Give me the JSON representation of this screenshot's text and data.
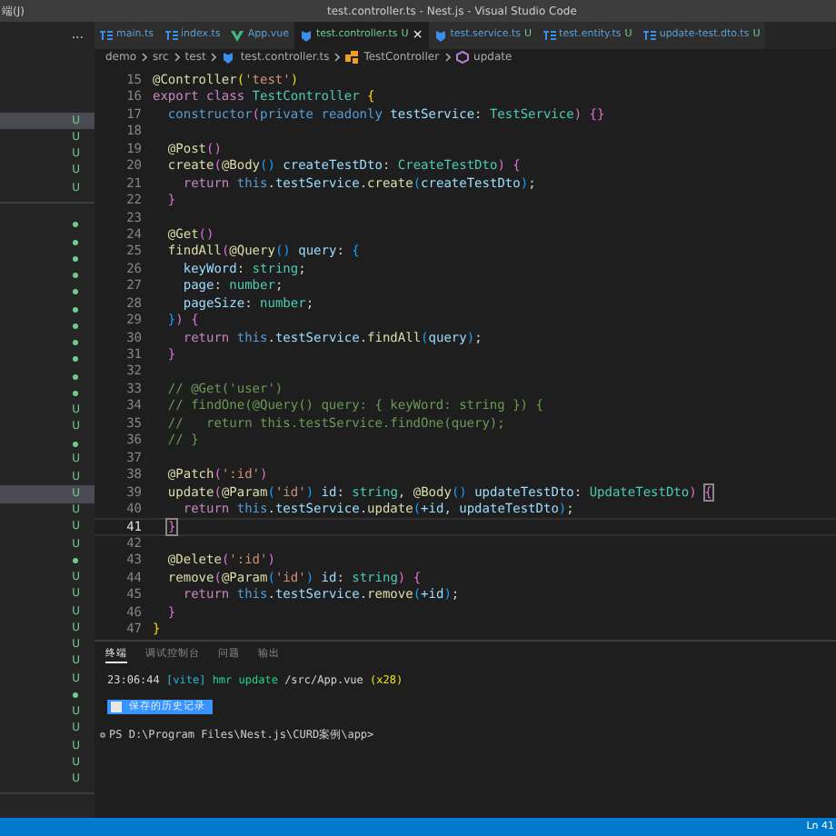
{
  "title_bar": {
    "menu_fragment": "端(J)",
    "title": "test.controller.ts - Nest.js - Visual Studio Code"
  },
  "sidebar": {
    "more": "...",
    "sections": [
      {
        "rows": [
          {
            "kind": "untracked",
            "mark": "U",
            "selected": true
          },
          {
            "kind": "untracked",
            "mark": "U",
            "selected": false
          },
          {
            "kind": "untracked",
            "mark": "U",
            "selected": false
          },
          {
            "kind": "untracked",
            "mark": "U",
            "selected": false
          },
          {
            "kind": "untracked",
            "mark": "U",
            "selected": false
          }
        ]
      },
      {
        "rows": [
          {
            "kind": "dot",
            "selected": false
          },
          {
            "kind": "dot",
            "selected": false
          },
          {
            "kind": "dot",
            "selected": false
          },
          {
            "kind": "dot",
            "selected": false
          },
          {
            "kind": "dot",
            "selected": false
          },
          {
            "kind": "dot",
            "selected": false
          },
          {
            "kind": "dot",
            "selected": false
          },
          {
            "kind": "dot",
            "selected": false
          },
          {
            "kind": "dot",
            "selected": false
          },
          {
            "kind": "dot",
            "selected": false
          },
          {
            "kind": "dot",
            "selected": false
          },
          {
            "kind": "untracked",
            "mark": "U",
            "selected": false
          },
          {
            "kind": "untracked",
            "mark": "U",
            "selected": false
          },
          {
            "kind": "dot",
            "selected": false
          },
          {
            "kind": "untracked",
            "mark": "U",
            "selected": false
          },
          {
            "kind": "untracked",
            "mark": "U",
            "selected": false
          },
          {
            "kind": "untracked",
            "mark": "U",
            "selected": true
          },
          {
            "kind": "untracked",
            "mark": "U",
            "selected": false
          },
          {
            "kind": "untracked",
            "mark": "U",
            "selected": false
          },
          {
            "kind": "untracked",
            "mark": "U",
            "selected": false
          },
          {
            "kind": "dot",
            "selected": false
          },
          {
            "kind": "untracked",
            "mark": "U",
            "selected": false
          },
          {
            "kind": "untracked",
            "mark": "U",
            "selected": false
          },
          {
            "kind": "untracked",
            "mark": "U",
            "selected": false
          },
          {
            "kind": "untracked",
            "mark": "U",
            "selected": false
          },
          {
            "kind": "untracked",
            "mark": "U",
            "selected": false
          },
          {
            "kind": "untracked",
            "mark": "U",
            "selected": false
          },
          {
            "kind": "untracked",
            "mark": "U",
            "selected": false
          },
          {
            "kind": "dot",
            "selected": false
          },
          {
            "kind": "untracked",
            "mark": "U",
            "selected": false
          },
          {
            "kind": "untracked",
            "mark": "U",
            "selected": false
          },
          {
            "kind": "untracked",
            "mark": "U",
            "selected": false
          },
          {
            "kind": "untracked",
            "mark": "U",
            "selected": false
          },
          {
            "kind": "untracked",
            "mark": "U",
            "selected": false
          }
        ]
      }
    ]
  },
  "tabs": [
    {
      "label": "main.ts",
      "kind": "ts",
      "selected": false
    },
    {
      "label": "index.ts",
      "kind": "ts",
      "selected": false
    },
    {
      "label": "App.vue",
      "kind": "vue",
      "selected": false
    },
    {
      "label": "test.controller.ts",
      "kind": "nest",
      "badge": "U",
      "close": "×",
      "selected": true
    },
    {
      "label": "test.service.ts",
      "kind": "nest",
      "badge": "U",
      "selected": false
    },
    {
      "label": "test.entity.ts",
      "kind": "ts",
      "badge": "U",
      "selected": false
    },
    {
      "label": "update-test.dto.ts",
      "kind": "ts",
      "badge": "U",
      "selected": false
    }
  ],
  "breadcrumb": [
    {
      "label": "demo",
      "kind": "folder"
    },
    {
      "label": "src",
      "kind": "folder"
    },
    {
      "label": "test",
      "kind": "folder"
    },
    {
      "label": "test.controller.ts",
      "kind": "file"
    },
    {
      "label": "TestController",
      "kind": "class"
    },
    {
      "label": "update",
      "kind": "method"
    }
  ],
  "code_lines": [
    {
      "number": "15",
      "current": false,
      "tokens": [
        {
          "text": "@Controller",
          "kind": "fn"
        },
        {
          "text": "(",
          "kind": "b1"
        },
        {
          "text": "'test'",
          "kind": "str"
        },
        {
          "text": ")",
          "kind": "b1"
        }
      ]
    },
    {
      "number": "16",
      "current": false,
      "tokens": [
        {
          "text": "export class ",
          "kind": "kw"
        },
        {
          "text": "TestController",
          "kind": "type"
        },
        {
          "text": " {",
          "kind": "b1"
        }
      ]
    },
    {
      "number": "17",
      "current": false,
      "tokens": [
        {
          "text": "  constructor",
          "kind": "st"
        },
        {
          "text": "(",
          "kind": "b2"
        },
        {
          "text": "private readonly ",
          "kind": "st"
        },
        {
          "text": "testService",
          "kind": "var"
        },
        {
          "text": ": ",
          "kind": "p"
        },
        {
          "text": "TestService",
          "kind": "type"
        },
        {
          "text": ")",
          "kind": "b2"
        },
        {
          "text": " {}",
          "kind": "b2"
        }
      ]
    },
    {
      "number": "18",
      "current": false
    },
    {
      "number": "19",
      "current": false,
      "tokens": [
        {
          "text": "  @Post",
          "kind": "fn"
        },
        {
          "text": "()",
          "kind": "b2"
        }
      ]
    },
    {
      "number": "20",
      "current": false,
      "tokens": [
        {
          "text": "  create",
          "kind": "fn"
        },
        {
          "text": "(",
          "kind": "b2"
        },
        {
          "text": "@Body",
          "kind": "fn"
        },
        {
          "text": "()",
          "kind": "b3"
        },
        {
          "text": " createTestDto",
          "kind": "var"
        },
        {
          "text": ": ",
          "kind": "p"
        },
        {
          "text": "CreateTestDto",
          "kind": "type"
        },
        {
          "text": ")",
          "kind": "b2"
        },
        {
          "text": " {",
          "kind": "b2"
        }
      ]
    },
    {
      "number": "21",
      "current": false,
      "tokens": [
        {
          "text": "    return",
          "kind": "kw"
        },
        {
          "text": " this",
          "kind": "st"
        },
        {
          "text": ".",
          "kind": "p"
        },
        {
          "text": "testService",
          "kind": "var"
        },
        {
          "text": ".",
          "kind": "p"
        },
        {
          "text": "create",
          "kind": "fn"
        },
        {
          "text": "(",
          "kind": "b3"
        },
        {
          "text": "createTestDto",
          "kind": "var"
        },
        {
          "text": ")",
          "kind": "b3"
        },
        {
          "text": ";",
          "kind": "p"
        }
      ]
    },
    {
      "number": "22",
      "current": false,
      "tokens": [
        {
          "text": "  }",
          "kind": "b2"
        }
      ]
    },
    {
      "number": "23",
      "current": false
    },
    {
      "number": "24",
      "current": false,
      "tokens": [
        {
          "text": "  @Get",
          "kind": "fn"
        },
        {
          "text": "()",
          "kind": "b2"
        }
      ]
    },
    {
      "number": "25",
      "current": false,
      "tokens": [
        {
          "text": "  findAll",
          "kind": "fn"
        },
        {
          "text": "(",
          "kind": "b2"
        },
        {
          "text": "@Query",
          "kind": "fn"
        },
        {
          "text": "()",
          "kind": "b3"
        },
        {
          "text": " query",
          "kind": "var"
        },
        {
          "text": ": ",
          "kind": "p"
        },
        {
          "text": "{",
          "kind": "b3"
        }
      ]
    },
    {
      "number": "26",
      "current": false,
      "tokens": [
        {
          "text": "    keyWord",
          "kind": "var"
        },
        {
          "text": ": ",
          "kind": "p"
        },
        {
          "text": "string",
          "kind": "type"
        },
        {
          "text": ";",
          "kind": "p"
        }
      ]
    },
    {
      "number": "27",
      "current": false,
      "tokens": [
        {
          "text": "    page",
          "kind": "var"
        },
        {
          "text": ": ",
          "kind": "p"
        },
        {
          "text": "number",
          "kind": "type"
        },
        {
          "text": ";",
          "kind": "p"
        }
      ]
    },
    {
      "number": "28",
      "current": false,
      "tokens": [
        {
          "text": "    pageSize",
          "kind": "var"
        },
        {
          "text": ": ",
          "kind": "p"
        },
        {
          "text": "number",
          "kind": "type"
        },
        {
          "text": ";",
          "kind": "p"
        }
      ]
    },
    {
      "number": "29",
      "current": false,
      "tokens": [
        {
          "text": "  }",
          "kind": "b3"
        },
        {
          "text": ")",
          "kind": "b2"
        },
        {
          "text": " {",
          "kind": "b2"
        }
      ]
    },
    {
      "number": "30",
      "current": false,
      "tokens": [
        {
          "text": "    return",
          "kind": "kw"
        },
        {
          "text": " this",
          "kind": "st"
        },
        {
          "text": ".",
          "kind": "p"
        },
        {
          "text": "testService",
          "kind": "var"
        },
        {
          "text": ".",
          "kind": "p"
        },
        {
          "text": "findAll",
          "kind": "fn"
        },
        {
          "text": "(",
          "kind": "b3"
        },
        {
          "text": "query",
          "kind": "var"
        },
        {
          "text": ")",
          "kind": "b3"
        },
        {
          "text": ";",
          "kind": "p"
        }
      ]
    },
    {
      "number": "31",
      "current": false,
      "tokens": [
        {
          "text": "  }",
          "kind": "b2"
        }
      ]
    },
    {
      "number": "32",
      "current": false
    },
    {
      "number": "33",
      "current": false,
      "tokens": [
        {
          "text": "  // @Get('user')",
          "kind": "com"
        }
      ]
    },
    {
      "number": "34",
      "current": false,
      "tokens": [
        {
          "text": "  // findOne(@Query() query: { keyWord: string }) {",
          "kind": "com"
        }
      ]
    },
    {
      "number": "35",
      "current": false,
      "tokens": [
        {
          "text": "  //   return this.testService.findOne(query);",
          "kind": "com"
        }
      ]
    },
    {
      "number": "36",
      "current": false,
      "tokens": [
        {
          "text": "  // }",
          "kind": "com"
        }
      ]
    },
    {
      "number": "37",
      "current": false
    },
    {
      "number": "38",
      "current": false,
      "tokens": [
        {
          "text": "  @Patch",
          "kind": "fn"
        },
        {
          "text": "(",
          "kind": "b2"
        },
        {
          "text": "':id'",
          "kind": "str"
        },
        {
          "text": ")",
          "kind": "b2"
        }
      ]
    },
    {
      "number": "39",
      "current": false,
      "tokens": [
        {
          "text": "  update",
          "kind": "fn"
        },
        {
          "text": "(",
          "kind": "b2"
        },
        {
          "text": "@Param",
          "kind": "fn"
        },
        {
          "text": "(",
          "kind": "b3"
        },
        {
          "text": "'id'",
          "kind": "str"
        },
        {
          "text": ")",
          "kind": "b3"
        },
        {
          "text": " id",
          "kind": "var"
        },
        {
          "text": ": ",
          "kind": "p"
        },
        {
          "text": "string",
          "kind": "type"
        },
        {
          "text": ", ",
          "kind": "p"
        },
        {
          "text": "@Body",
          "kind": "fn"
        },
        {
          "text": "()",
          "kind": "b3"
        },
        {
          "text": " updateTestDto",
          "kind": "var"
        },
        {
          "text": ": ",
          "kind": "p"
        },
        {
          "text": "UpdateTestDto",
          "kind": "type"
        },
        {
          "text": ")",
          "kind": "b2"
        },
        {
          "text": " {",
          "kind": "mb2"
        }
      ]
    },
    {
      "number": "40",
      "current": false,
      "tokens": [
        {
          "text": "    return",
          "kind": "kw"
        },
        {
          "text": " this",
          "kind": "st"
        },
        {
          "text": ".",
          "kind": "p"
        },
        {
          "text": "testService",
          "kind": "var"
        },
        {
          "text": ".",
          "kind": "p"
        },
        {
          "text": "update",
          "kind": "fn"
        },
        {
          "text": "(",
          "kind": "b3"
        },
        {
          "text": "+id, updateTestDto",
          "kind": "var"
        },
        {
          "text": ")",
          "kind": "b3"
        },
        {
          "text": ";",
          "kind": "p"
        }
      ]
    },
    {
      "number": "41",
      "current": true,
      "tokens": [
        {
          "text": "  }",
          "kind": "mb2"
        }
      ]
    },
    {
      "number": "42",
      "current": false
    },
    {
      "number": "43",
      "current": false,
      "tokens": [
        {
          "text": "  @Delete",
          "kind": "fn"
        },
        {
          "text": "(",
          "kind": "b2"
        },
        {
          "text": "':id'",
          "kind": "str"
        },
        {
          "text": ")",
          "kind": "b2"
        }
      ]
    },
    {
      "number": "44",
      "current": false,
      "tokens": [
        {
          "text": "  remove",
          "kind": "fn"
        },
        {
          "text": "(",
          "kind": "b2"
        },
        {
          "text": "@Param",
          "kind": "fn"
        },
        {
          "text": "(",
          "kind": "b3"
        },
        {
          "text": "'id'",
          "kind": "str"
        },
        {
          "text": ")",
          "kind": "b3"
        },
        {
          "text": " id",
          "kind": "var"
        },
        {
          "text": ": ",
          "kind": "p"
        },
        {
          "text": "string",
          "kind": "type"
        },
        {
          "text": ")",
          "kind": "b2"
        },
        {
          "text": " {",
          "kind": "b2"
        }
      ]
    },
    {
      "number": "45",
      "current": false,
      "tokens": [
        {
          "text": "    return",
          "kind": "kw"
        },
        {
          "text": " this",
          "kind": "st"
        },
        {
          "text": ".",
          "kind": "p"
        },
        {
          "text": "testService",
          "kind": "var"
        },
        {
          "text": ".",
          "kind": "p"
        },
        {
          "text": "remove",
          "kind": "fn"
        },
        {
          "text": "(",
          "kind": "b3"
        },
        {
          "text": "+id",
          "kind": "var"
        },
        {
          "text": ")",
          "kind": "b3"
        },
        {
          "text": ";",
          "kind": "p"
        }
      ]
    },
    {
      "number": "46",
      "current": false,
      "tokens": [
        {
          "text": "  }",
          "kind": "b2"
        }
      ]
    },
    {
      "number": "47",
      "current": false,
      "tokens": [
        {
          "text": "}",
          "kind": "b1"
        }
      ]
    }
  ],
  "panel": {
    "tabs": [
      {
        "label": "终端",
        "selected": true
      },
      {
        "label": "调试控制台",
        "selected": false
      },
      {
        "label": "问题",
        "selected": false
      },
      {
        "label": "输出",
        "selected": false
      }
    ],
    "log_line": [
      {
        "text": "23:06:44 ",
        "kind": "p"
      },
      {
        "text": "[vite]",
        "kind": "cyan"
      },
      {
        "text": " hmr update ",
        "kind": "green"
      },
      {
        "text": "/src/App.vue ",
        "kind": "p"
      },
      {
        "text": "(x28)",
        "kind": "yellow"
      }
    ],
    "history_marker": "保存的历史记录",
    "prompt": "PS D:\\Program Files\\Nest.js\\CURD案例\\app>"
  },
  "status_bar": {
    "position": "Ln 41"
  }
}
